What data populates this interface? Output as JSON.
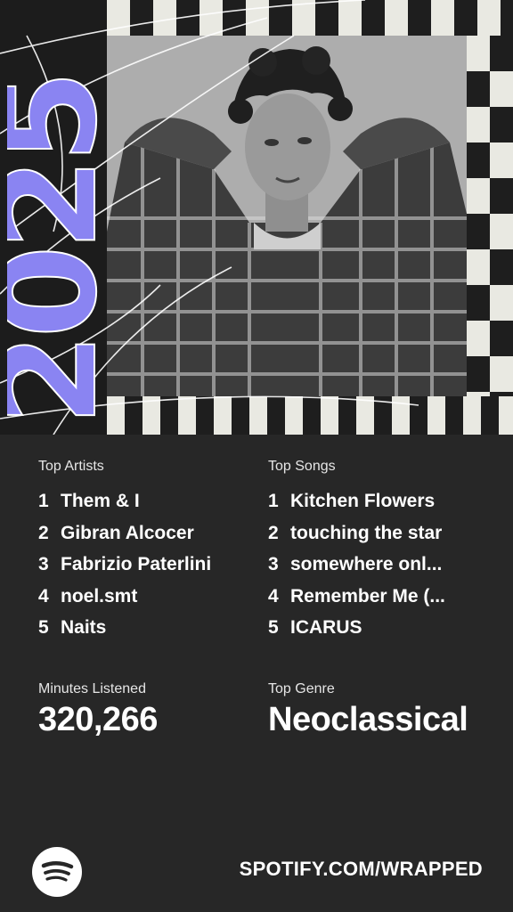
{
  "year": "2025",
  "top_artists": {
    "label": "Top Artists",
    "items": [
      {
        "rank": "1",
        "name": "Them & I"
      },
      {
        "rank": "2",
        "name": "Gibran Alcocer"
      },
      {
        "rank": "3",
        "name": "Fabrizio Paterlini"
      },
      {
        "rank": "4",
        "name": "noel.smt"
      },
      {
        "rank": "5",
        "name": "Naits"
      }
    ]
  },
  "top_songs": {
    "label": "Top Songs",
    "items": [
      {
        "rank": "1",
        "name": "Kitchen Flowers"
      },
      {
        "rank": "2",
        "name": "touching the star"
      },
      {
        "rank": "3",
        "name": "somewhere onl..."
      },
      {
        "rank": "4",
        "name": "Remember Me (..."
      },
      {
        "rank": "5",
        "name": "ICARUS"
      }
    ]
  },
  "minutes_listened": {
    "label": "Minutes Listened",
    "value": "320,266"
  },
  "top_genre": {
    "label": "Top Genre",
    "value": "Neoclassical"
  },
  "footer": {
    "url": "SPOTIFY.COM/WRAPPED",
    "logo_icon": "spotify-logo-icon"
  },
  "colors": {
    "background": "#272727",
    "accent": "#8a84f2",
    "stripe_light": "#e9e9e2",
    "stripe_dark": "#1e1e1e"
  }
}
